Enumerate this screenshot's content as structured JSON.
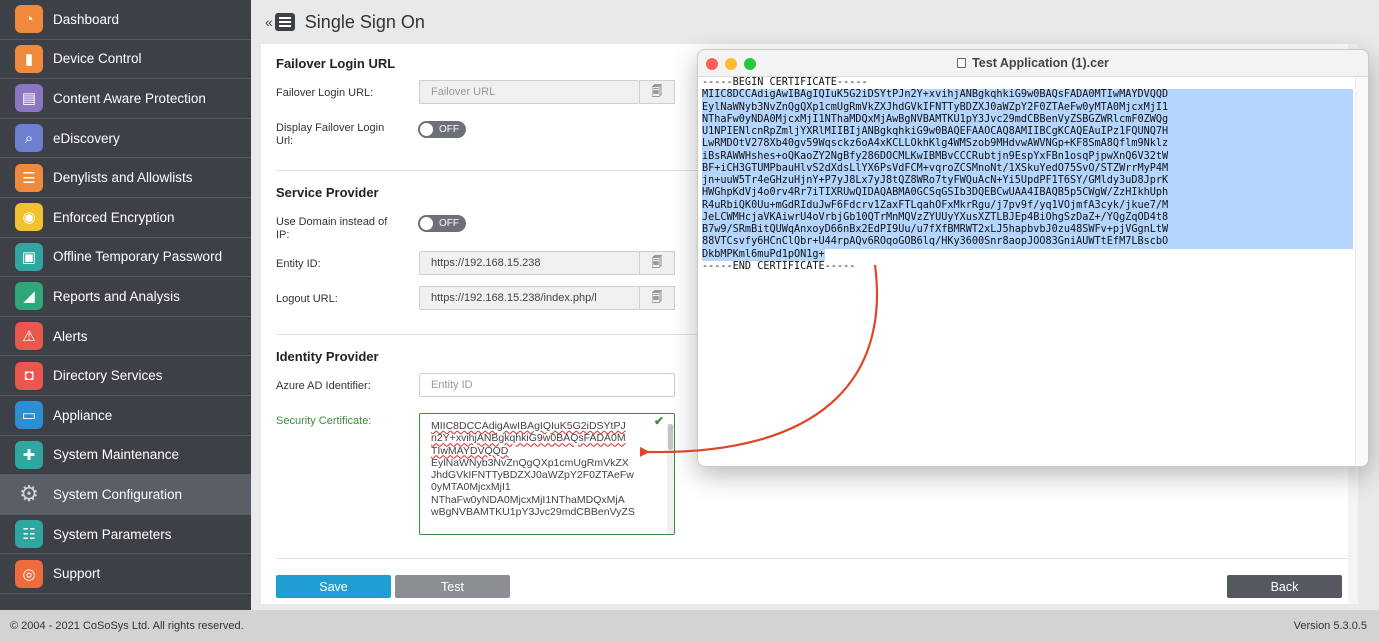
{
  "sidebar": {
    "items": [
      {
        "label": "Dashboard",
        "icon": "dashboard-icon",
        "color": "#ef8a3d",
        "glyph": "◔"
      },
      {
        "label": "Device Control",
        "icon": "usb-icon",
        "color": "#ef8a3d",
        "glyph": "▮"
      },
      {
        "label": "Content Aware Protection",
        "icon": "document-search-icon",
        "color": "#8b76c2",
        "glyph": "▤"
      },
      {
        "label": "eDiscovery",
        "icon": "telescope-icon",
        "color": "#6d7fcf",
        "glyph": "⌕"
      },
      {
        "label": "Denylists and Allowlists",
        "icon": "list-icon",
        "color": "#ef8a3d",
        "glyph": "☰"
      },
      {
        "label": "Enforced Encryption",
        "icon": "encryption-icon",
        "color": "#f2c12e",
        "glyph": "◉"
      },
      {
        "label": "Offline Temporary Password",
        "icon": "password-icon",
        "color": "#2fa7a0",
        "glyph": "▣"
      },
      {
        "label": "Reports and Analysis",
        "icon": "chart-icon",
        "color": "#2fa77a",
        "glyph": "◢"
      },
      {
        "label": "Alerts",
        "icon": "alert-icon",
        "color": "#e9574d",
        "glyph": "⚠"
      },
      {
        "label": "Directory Services",
        "icon": "directory-icon",
        "color": "#e9574d",
        "glyph": "◘"
      },
      {
        "label": "Appliance",
        "icon": "appliance-icon",
        "color": "#2b8fd6",
        "glyph": "▭"
      },
      {
        "label": "System Maintenance",
        "icon": "tools-icon",
        "color": "#2fa7a0",
        "glyph": "✚"
      },
      {
        "label": "System Configuration",
        "icon": "gear-icon",
        "color": "#9a9da3",
        "glyph": "⚙"
      },
      {
        "label": "System Parameters",
        "icon": "parameters-icon",
        "color": "#2fa7a0",
        "glyph": "☷"
      },
      {
        "label": "Support",
        "icon": "support-icon",
        "color": "#ef6a3d",
        "glyph": "◎"
      }
    ],
    "active_index": 12
  },
  "header": {
    "collapse": "«",
    "title": "Single Sign On"
  },
  "failover": {
    "title": "Failover Login URL",
    "url_label": "Failover Login URL:",
    "url_placeholder": "Failover URL",
    "display_label": "Display Failover Login Url:",
    "display_toggle": "OFF"
  },
  "service_provider": {
    "title": "Service Provider",
    "use_domain_label": "Use Domain instead of IP:",
    "use_domain_toggle": "OFF",
    "entity_label": "Entity ID:",
    "entity_value": "https://192.168.15.238",
    "logout_label": "Logout URL:",
    "logout_value": "https://192.168.15.238/index.php/l"
  },
  "identity_provider": {
    "title": "Identity Provider",
    "azure_label": "Azure AD Identifier:",
    "azure_placeholder": "Entity ID",
    "cert_label": "Security Certificate:",
    "cert_lines_err": [
      "MIIC8DCCAdigAwIBAgIQIuK5G2iDSYtPJ",
      "n2Y+xvihjANBgkqhkiG9w0BAQsFADA0M",
      "TIwMAYDVQQD"
    ],
    "cert_lines": [
      "EylNaWNyb3NvZnQgQXp1cmUgRmVkZX",
      "JhdGVkIFNTTyBDZXJ0aWZpY2F0ZTAeFw",
      "0yMTA0MjcxMjI1",
      "NThaFw0yNDA0MjcxMjI1NThaMDQxMjA",
      "wBgNVBAMTKU1pY3Jvc29mdCBBenVyZS"
    ]
  },
  "buttons": {
    "save": "Save",
    "test": "Test",
    "back": "Back"
  },
  "footer": {
    "copyright": "© 2004 - 2021 CoSoSys Ltd. All rights reserved.",
    "version": "Version 5.3.0.5"
  },
  "viewer": {
    "title": "Test Application (1).cer",
    "begin": "-----BEGIN CERTIFICATE-----",
    "lines": [
      "MIIC8DCCAdigAwIBAgIQIuK5G2iDSYtPJn2Y+xvihjANBgkqhkiG9w0BAQsFADA0MTIwMAYDVQQD",
      "EylNaWNyb3NvZnQgQXp1cmUgRmVkZXJhdGVkIFNTTyBDZXJ0aWZpY2F0ZTAeFw0yMTA0MjcxMjI1",
      "NThaFw0yNDA0MjcxMjI1NThaMDQxMjAwBgNVBAMTKU1pY3Jvc29mdCBBenVyZSBGZWRlcmF0ZWQg",
      "U1NPIENlcnRpZmljYXRlMIIBIjANBgkqhkiG9w0BAQEFAAOCAQ8AMIIBCgKCAQEAuIPz1FQUNQ7H",
      "LwRMDOtV278Xb40gv59Wqsckz6oA4xKCLLOkhKlg4WMSzob9MHdvwAWVNGp+KF8SmA8Qflm9Nklz",
      "iBsRAWWHshes+oQKaoZY2NgBfy286DOCMLKwIBMBvCCCRubtjn9EspYxFBn1osqPjpwXnQ6V32tW",
      "BF+iCH3GTUMPbauHlvS2dXdsLlYX6PsVdFCM+vqroZCSMnoNt/1XSkuYedO75SvO/STZWrrMyP4M",
      "jn+uuW5Tr4eGHzuHjnY+P7yJ8Lx7yJ8tQZ8WRo7tyFWQuAcN+Yi5UpdPF1T6SY/GMldy3uD8JprK",
      "HWGhpKdVj4o0rv4Rr7iTIXRUwQIDAQABMA0GCSqGSIb3DQEBCwUAA4IBAQB5p5CWgW/ZzHIkhUph",
      "R4uRbiQK0Uu+mGdRIduJwF6Fdcrv1ZaxFTLqahOFxMkrRgu/j7pv9f/yq1VOjmfA3cyk/jkue7/M",
      "JeLCWMHcjaVKAiwrU4oVrbjGb10QTrMnMQVzZYUUyYXusXZTLBJEp4BiOhgSzDaZ+/YQgZqOD4t8",
      "B7w9/SRmBitQUWqAnxoyD66nBx2EdPI9Uu/u7fXfBMRWT2xLJ5hapbvbJ0zu48SWFv+pjVGgnLtW",
      "88VTCsvfy6HCnClQbr+U44rpAQv6ROqoGOB6lq/HKy3600Snr8aopJOO83GniAUWTtEfM7LBscbO",
      "DkbMPKml6muPd1pON1g+"
    ],
    "end": "-----END CERTIFICATE-----"
  }
}
